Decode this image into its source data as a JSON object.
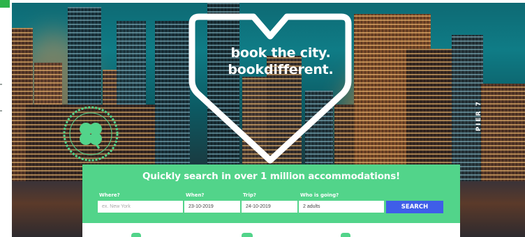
{
  "hero": {
    "tagline_line1": "book the city.",
    "tagline_line2": "bookdifferent.",
    "building_sign": "PIER 7",
    "badge_icon": "clover-icon"
  },
  "search": {
    "title": "Quickly search in over 1 million accommodations!",
    "where_label": "Where?",
    "where_placeholder": "ex. New York",
    "when_label": "When?",
    "when_value": "23-10-2019",
    "trip_label": "Trip?",
    "trip_value": "24-10-2019",
    "who_label": "Who is going?",
    "who_value": "2 adults",
    "button_label": "SEARCH"
  },
  "colors": {
    "brand_green": "#52d48a",
    "search_button": "#3f5ee8",
    "corner_tag": "#2db34a"
  }
}
